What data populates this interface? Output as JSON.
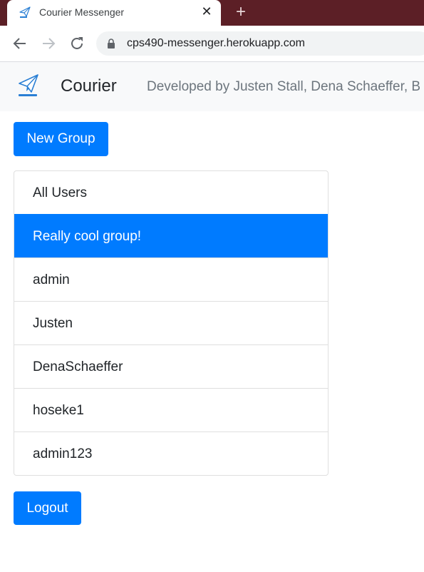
{
  "browser": {
    "tab_title": "Courier Messenger",
    "tab_close": "✕",
    "new_tab": "+",
    "url": "cps490-messenger.herokuapp.com",
    "icons": [
      "back-icon",
      "forward-icon",
      "reload-icon",
      "lock-icon"
    ]
  },
  "navbar": {
    "brand_name": "Courier",
    "developed_by": "Developed by Justen Stall, Dena Schaeffer, B"
  },
  "actions": {
    "new_group_label": "New Group",
    "logout_label": "Logout"
  },
  "list": {
    "active_index": 1,
    "items": [
      {
        "label": "All Users"
      },
      {
        "label": "Really cool group!"
      },
      {
        "label": "admin"
      },
      {
        "label": "Justen"
      },
      {
        "label": "DenaSchaeffer"
      },
      {
        "label": "hoseke1"
      },
      {
        "label": "admin123"
      }
    ]
  },
  "colors": {
    "primary": "#007bff",
    "tabstrip": "#5c1f26",
    "navbar_bg": "#f8f9fa",
    "muted_text": "#6c757d"
  }
}
